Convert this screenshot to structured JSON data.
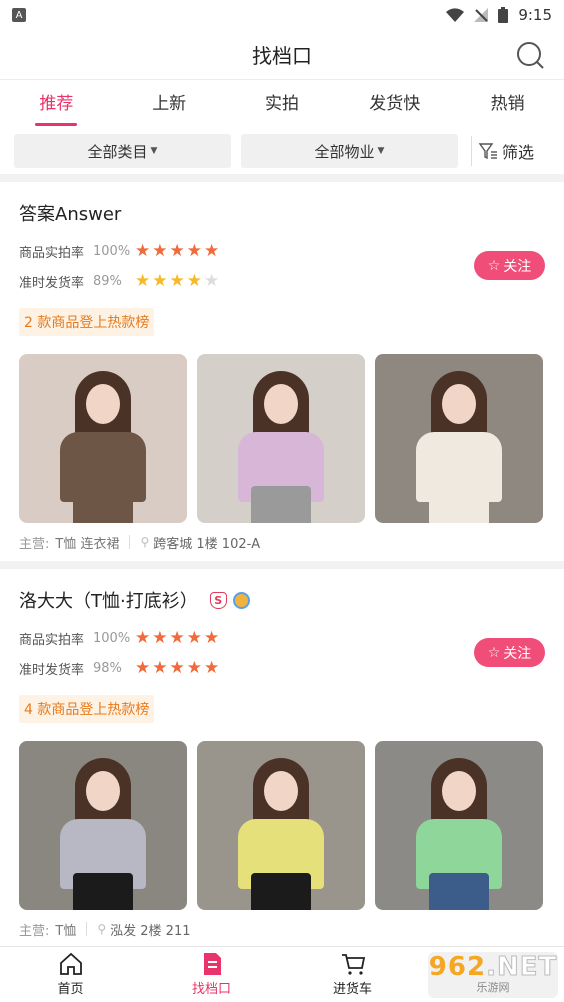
{
  "status_bar": {
    "time": "9:15"
  },
  "header": {
    "title": "找档口"
  },
  "tabs": [
    {
      "label": "推荐",
      "active": true
    },
    {
      "label": "上新",
      "active": false
    },
    {
      "label": "实拍",
      "active": false
    },
    {
      "label": "发货快",
      "active": false
    },
    {
      "label": "热销",
      "active": false
    }
  ],
  "filters": {
    "category": "全部类目",
    "property": "全部物业",
    "filter_label": "筛选"
  },
  "shops": [
    {
      "name": "答案Answer",
      "photo_rate_label": "商品实拍率",
      "photo_rate": "100%",
      "photo_stars": 5,
      "ontime_label": "准时发货率",
      "ontime_rate": "89%",
      "ontime_stars": 4,
      "follow_label": "关注",
      "hot_tag": "2 款商品登上热款榜",
      "main_label": "主营:",
      "categories": "T恤   连衣裙",
      "address": "跨客城 1楼 102-A",
      "images": [
        {
          "bg": "#d9ccc4",
          "top": "#6e5646",
          "bottom": "#6e5646"
        },
        {
          "bg": "#d4cfc9",
          "top": "#d8b6d8",
          "bottom": "#9a9a9a"
        },
        {
          "bg": "#8f8880",
          "top": "#efe9e0",
          "bottom": "#efe9e0"
        }
      ]
    },
    {
      "name": "洛大大（T恤·打底衫）",
      "badges": true,
      "photo_rate_label": "商品实拍率",
      "photo_rate": "100%",
      "photo_stars": 5,
      "ontime_label": "准时发货率",
      "ontime_rate": "98%",
      "ontime_stars": 5,
      "follow_label": "关注",
      "hot_tag": "4 款商品登上热款榜",
      "main_label": "主营:",
      "categories": "T恤",
      "address": "泓发 2楼 211",
      "images": [
        {
          "bg": "#8a8680",
          "top": "#b7b8c4",
          "bottom": "#1b1b1b"
        },
        {
          "bg": "#9a958c",
          "top": "#e6e07a",
          "bottom": "#1b1b1b"
        },
        {
          "bg": "#8c8a86",
          "top": "#8fd69a",
          "bottom": "#3c5c8a"
        }
      ]
    }
  ],
  "bottom_nav": [
    {
      "label": "首页",
      "active": false
    },
    {
      "label": "找档口",
      "active": true
    },
    {
      "label": "进货车",
      "active": false
    },
    {
      "label": "",
      "active": false
    }
  ],
  "watermark": {
    "brand_a": "962",
    "brand_b": ".NET",
    "sub": "乐游网"
  },
  "colors": {
    "accent": "#e8346a",
    "star_red": "#f06a3c",
    "star_gold": "#f6b92a",
    "hot_tag": "#e87a1c"
  }
}
